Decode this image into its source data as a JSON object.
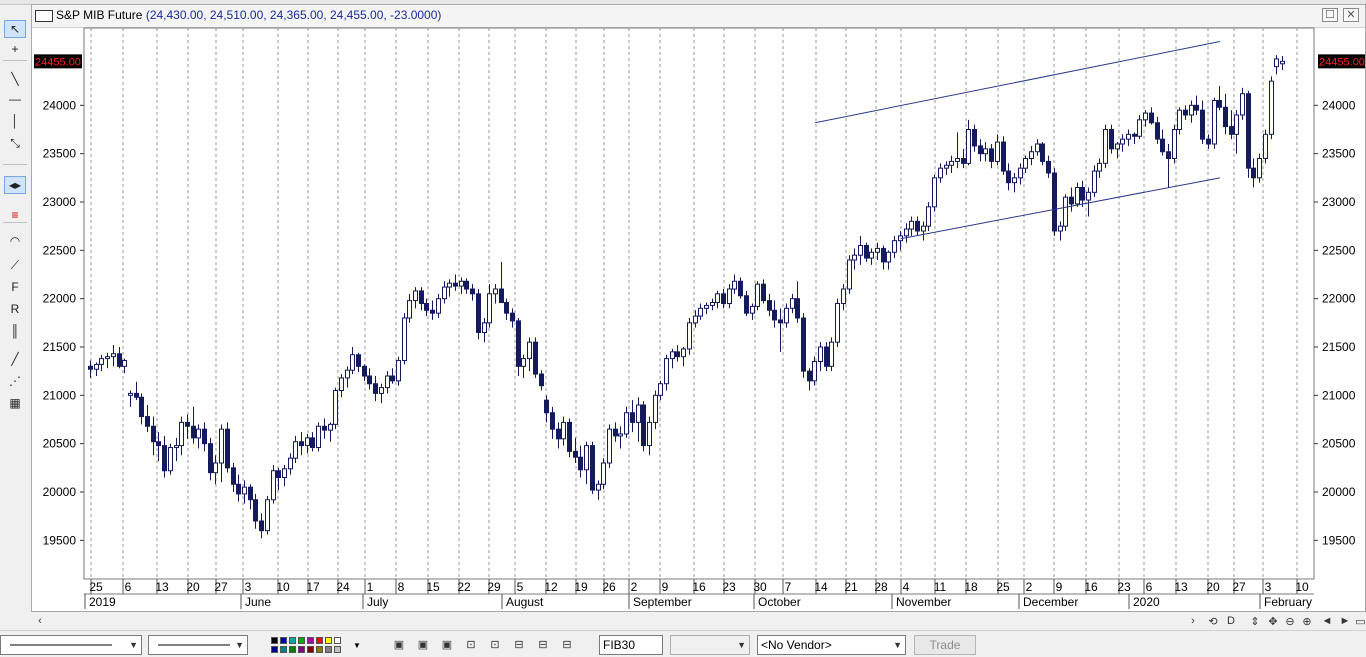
{
  "window": {
    "symbol": "S&P MIB Future",
    "ohlc": "(24,430.00, 24,510.00, 24,365.00, 24,455.00, -23.0000)",
    "restore_glyph": "☐",
    "close_glyph": "✕"
  },
  "price_tag": "24455.00",
  "tools": [
    {
      "name": "pointer-tool-icon",
      "glyph": "↖"
    },
    {
      "name": "crosshair-tool-icon",
      "glyph": "+"
    },
    {
      "name": "trendline-tool-icon",
      "glyph": "╲"
    },
    {
      "name": "horizontal-line-tool-icon",
      "glyph": "—"
    },
    {
      "name": "vertical-line-tool-icon",
      "glyph": "│"
    },
    {
      "name": "cycle-tool-icon",
      "glyph": "⤡"
    },
    {
      "name": "cursor-both-icon",
      "glyph": "◂▸"
    },
    {
      "name": "color-bars-tool-icon",
      "glyph": "≡"
    },
    {
      "name": "arc-tool-icon",
      "glyph": "◠"
    },
    {
      "name": "fan-tool-icon",
      "glyph": "⟋"
    },
    {
      "name": "fibonacci-tool-icon",
      "glyph": "F"
    },
    {
      "name": "retracement-tool-icon",
      "glyph": "R"
    },
    {
      "name": "time-zones-tool-icon",
      "glyph": "║"
    },
    {
      "name": "line-tool-icon",
      "glyph": "╱"
    },
    {
      "name": "speed-lines-tool-icon",
      "glyph": "⋰"
    },
    {
      "name": "grid-tool-icon",
      "glyph": "▦"
    }
  ],
  "colors": {
    "up": "#ffffff",
    "down": "#141a5c",
    "outline": "#141a5c",
    "channel": "#2a3a8c",
    "price_tag_bg": "#000000",
    "price_tag_fg": "#ff2020"
  },
  "chart_data": {
    "type": "candlestick",
    "symbol": "S&P MIB Future",
    "y_ticks": [
      "24000",
      "23500",
      "23000",
      "22500",
      "22000",
      "21500",
      "21000",
      "20500",
      "20000",
      "19500"
    ],
    "ylim": [
      19100,
      24800
    ],
    "x_day_labels": [
      "25",
      "6",
      "13",
      "20",
      "27",
      "3",
      "10",
      "17",
      "24",
      "1",
      "8",
      "15",
      "22",
      "29",
      "5",
      "12",
      "19",
      "26",
      "2",
      "9",
      "16",
      "23",
      "30",
      "7",
      "14",
      "21",
      "28",
      "4",
      "11",
      "18",
      "25",
      "2",
      "9",
      "16",
      "23",
      "6",
      "13",
      "20",
      "27",
      "3",
      "10"
    ],
    "x_month_labels": [
      "2019",
      "June",
      "July",
      "August",
      "September",
      "October",
      "November",
      "December",
      "2020",
      "February"
    ],
    "last": {
      "open": 24430.0,
      "high": 24510.0,
      "low": 24365.0,
      "close": 24455.0,
      "change": -23.0
    },
    "channel_lines": [
      {
        "from": {
          "date": "2019-11-11",
          "value": 23820
        },
        "to": {
          "date": "2020-02-11",
          "value": 24660
        }
      },
      {
        "from": {
          "date": "2019-12-02",
          "value": 22620
        },
        "to": {
          "date": "2020-02-11",
          "value": 23250
        }
      }
    ],
    "bars": [
      [
        21300,
        21360,
        21180,
        21270
      ],
      [
        21270,
        21340,
        21200,
        21320
      ],
      [
        21320,
        21420,
        21250,
        21380
      ],
      [
        21380,
        21440,
        21280,
        21400
      ],
      [
        21400,
        21520,
        21300,
        21430
      ],
      [
        21430,
        21500,
        21280,
        21300
      ],
      [
        21300,
        21380,
        21230,
        21360
      ],
      [
        21000,
        21050,
        20880,
        21020
      ],
      [
        21020,
        21140,
        20950,
        20980
      ],
      [
        20980,
        21020,
        20700,
        20780
      ],
      [
        20780,
        20900,
        20620,
        20680
      ],
      [
        20680,
        20780,
        20380,
        20520
      ],
      [
        20520,
        20620,
        20320,
        20480
      ],
      [
        20480,
        20580,
        20150,
        20220
      ],
      [
        20220,
        20500,
        20180,
        20460
      ],
      [
        20460,
        20560,
        20320,
        20480
      ],
      [
        20480,
        20780,
        20380,
        20720
      ],
      [
        20720,
        20800,
        20550,
        20680
      ],
      [
        20680,
        20880,
        20500,
        20560
      ],
      [
        20560,
        20700,
        20450,
        20650
      ],
      [
        20650,
        20720,
        20420,
        20500
      ],
      [
        20500,
        20560,
        20120,
        20200
      ],
      [
        20200,
        20380,
        20080,
        20300
      ],
      [
        20300,
        20700,
        20100,
        20650
      ],
      [
        20650,
        20720,
        20200,
        20250
      ],
      [
        20250,
        20300,
        20000,
        20080
      ],
      [
        20080,
        20180,
        19900,
        19980
      ],
      [
        19980,
        20120,
        19880,
        20050
      ],
      [
        20050,
        20080,
        19820,
        19920
      ],
      [
        19920,
        19980,
        19620,
        19700
      ],
      [
        19700,
        19780,
        19520,
        19600
      ],
      [
        19600,
        19960,
        19560,
        19920
      ],
      [
        19920,
        20280,
        19880,
        20220
      ],
      [
        20220,
        20250,
        20020,
        20150
      ],
      [
        20150,
        20280,
        20060,
        20240
      ],
      [
        20240,
        20400,
        20180,
        20350
      ],
      [
        20350,
        20580,
        20300,
        20520
      ],
      [
        20520,
        20620,
        20380,
        20480
      ],
      [
        20480,
        20600,
        20400,
        20560
      ],
      [
        20560,
        20620,
        20420,
        20460
      ],
      [
        20460,
        20720,
        20420,
        20680
      ],
      [
        20680,
        20760,
        20550,
        20640
      ],
      [
        20640,
        20720,
        20520,
        20700
      ],
      [
        20700,
        21080,
        20650,
        21050
      ],
      [
        21050,
        21220,
        20980,
        21180
      ],
      [
        21180,
        21300,
        21080,
        21260
      ],
      [
        21260,
        21500,
        21220,
        21420
      ],
      [
        21420,
        21440,
        21240,
        21300
      ],
      [
        21300,
        21320,
        21150,
        21200
      ],
      [
        21200,
        21280,
        21060,
        21120
      ],
      [
        21120,
        21200,
        20940,
        21020
      ],
      [
        21020,
        21120,
        20920,
        21080
      ],
      [
        21080,
        21250,
        21020,
        21200
      ],
      [
        21200,
        21280,
        21120,
        21150
      ],
      [
        21150,
        21400,
        21100,
        21360
      ],
      [
        21360,
        21850,
        21320,
        21800
      ],
      [
        21800,
        22050,
        21750,
        21980
      ],
      [
        21980,
        22120,
        21900,
        22080
      ],
      [
        22080,
        22120,
        21880,
        21950
      ],
      [
        21950,
        22000,
        21820,
        21880
      ],
      [
        21880,
        21980,
        21780,
        21850
      ],
      [
        21850,
        22050,
        21800,
        22000
      ],
      [
        22000,
        22180,
        21950,
        22120
      ],
      [
        22120,
        22200,
        22020,
        22160
      ],
      [
        22160,
        22250,
        22080,
        22130
      ],
      [
        22130,
        22220,
        22050,
        22180
      ],
      [
        22180,
        22210,
        22050,
        22100
      ],
      [
        22100,
        22150,
        21980,
        22050
      ],
      [
        22050,
        22100,
        21580,
        21650
      ],
      [
        21650,
        21800,
        21550,
        21750
      ],
      [
        21750,
        22150,
        21700,
        22050
      ],
      [
        22050,
        22150,
        21950,
        22100
      ],
      [
        22100,
        22380,
        22000,
        21960
      ],
      [
        21960,
        22000,
        21780,
        21850
      ],
      [
        21850,
        21900,
        21700,
        21770
      ],
      [
        21770,
        21800,
        21200,
        21300
      ],
      [
        21300,
        21420,
        21180,
        21380
      ],
      [
        21380,
        21600,
        21250,
        21550
      ],
      [
        21550,
        21600,
        21180,
        21220
      ],
      [
        21220,
        21260,
        21050,
        21100
      ],
      [
        20950,
        21000,
        20720,
        20820
      ],
      [
        20820,
        20880,
        20550,
        20650
      ],
      [
        20650,
        20720,
        20450,
        20550
      ],
      [
        20550,
        20780,
        20480,
        20720
      ],
      [
        20720,
        20760,
        20360,
        20420
      ],
      [
        20420,
        20560,
        20300,
        20360
      ],
      [
        20360,
        20480,
        20150,
        20230
      ],
      [
        20230,
        20520,
        20080,
        20480
      ],
      [
        20480,
        20520,
        19980,
        20020
      ],
      [
        20020,
        20120,
        19920,
        20080
      ],
      [
        20080,
        20350,
        20030,
        20300
      ],
      [
        20300,
        20700,
        20250,
        20650
      ],
      [
        20650,
        20720,
        20520,
        20580
      ],
      [
        20580,
        20680,
        20450,
        20600
      ],
      [
        20600,
        20880,
        20560,
        20820
      ],
      [
        20820,
        20950,
        20620,
        20720
      ],
      [
        20720,
        20980,
        20520,
        20900
      ],
      [
        20900,
        20940,
        20420,
        20480
      ],
      [
        20480,
        20780,
        20380,
        20720
      ],
      [
        20720,
        21050,
        20650,
        21000
      ],
      [
        21000,
        21150,
        20950,
        21120
      ],
      [
        21120,
        21420,
        21050,
        21380
      ],
      [
        21380,
        21480,
        21280,
        21450
      ],
      [
        21450,
        21520,
        21350,
        21400
      ],
      [
        21400,
        21500,
        21300,
        21480
      ],
      [
        21480,
        21800,
        21420,
        21750
      ],
      [
        21750,
        21880,
        21700,
        21820
      ],
      [
        21820,
        21950,
        21780,
        21900
      ],
      [
        21900,
        21960,
        21840,
        21930
      ],
      [
        21930,
        22000,
        21880,
        21960
      ],
      [
        21960,
        22080,
        21900,
        22050
      ],
      [
        22050,
        22100,
        21900,
        21950
      ],
      [
        21950,
        22150,
        21900,
        22100
      ],
      [
        22100,
        22250,
        22050,
        22180
      ],
      [
        22180,
        22220,
        22000,
        22030
      ],
      [
        22030,
        22080,
        21820,
        21850
      ],
      [
        21850,
        21950,
        21780,
        21920
      ],
      [
        21920,
        22180,
        21880,
        22150
      ],
      [
        22150,
        22200,
        21950,
        21980
      ],
      [
        21980,
        22050,
        21820,
        21880
      ],
      [
        21880,
        21980,
        21700,
        21780
      ],
      [
        21780,
        21900,
        21450,
        21750
      ],
      [
        21750,
        21950,
        21700,
        21900
      ],
      [
        21900,
        22050,
        21850,
        22000
      ],
      [
        22000,
        22180,
        21750,
        21800
      ],
      [
        21800,
        21850,
        21180,
        21250
      ],
      [
        21250,
        21280,
        21050,
        21150
      ],
      [
        21150,
        21400,
        21100,
        21350
      ],
      [
        21350,
        21550,
        21250,
        21500
      ],
      [
        21500,
        21550,
        21250,
        21300
      ],
      [
        21300,
        21600,
        21250,
        21550
      ],
      [
        21550,
        22000,
        21500,
        21950
      ],
      [
        21950,
        22150,
        21880,
        22100
      ],
      [
        22100,
        22450,
        22050,
        22400
      ],
      [
        22400,
        22520,
        22300,
        22450
      ],
      [
        22450,
        22650,
        22350,
        22550
      ],
      [
        22550,
        22580,
        22380,
        22420
      ],
      [
        22420,
        22520,
        22350,
        22480
      ],
      [
        22480,
        22580,
        22400,
        22520
      ],
      [
        22520,
        22550,
        22300,
        22380
      ],
      [
        22380,
        22500,
        22300,
        22480
      ],
      [
        22480,
        22650,
        22420,
        22600
      ],
      [
        22600,
        22700,
        22500,
        22650
      ],
      [
        22650,
        22780,
        22580,
        22720
      ],
      [
        22720,
        22850,
        22650,
        22800
      ],
      [
        22800,
        22850,
        22650,
        22700
      ],
      [
        22700,
        22800,
        22600,
        22750
      ],
      [
        22750,
        23000,
        22700,
        22950
      ],
      [
        22950,
        23280,
        22900,
        23250
      ],
      [
        23250,
        23400,
        23200,
        23350
      ],
      [
        23350,
        23420,
        23280,
        23380
      ],
      [
        23380,
        23480,
        23300,
        23420
      ],
      [
        23420,
        23720,
        23350,
        23450
      ],
      [
        23450,
        23550,
        23350,
        23400
      ],
      [
        23400,
        23850,
        23380,
        23750
      ],
      [
        23750,
        23800,
        23520,
        23580
      ],
      [
        23580,
        23650,
        23420,
        23500
      ],
      [
        23500,
        23620,
        23420,
        23550
      ],
      [
        23550,
        23600,
        23350,
        23420
      ],
      [
        23420,
        23700,
        23380,
        23620
      ],
      [
        23620,
        23680,
        23280,
        23320
      ],
      [
        23320,
        23400,
        23120,
        23200
      ],
      [
        23200,
        23300,
        23100,
        23250
      ],
      [
        23250,
        23400,
        23180,
        23350
      ],
      [
        23350,
        23480,
        23300,
        23450
      ],
      [
        23450,
        23580,
        23380,
        23520
      ],
      [
        23520,
        23650,
        23480,
        23600
      ],
      [
        23600,
        23620,
        23380,
        23420
      ],
      [
        23420,
        23480,
        23250,
        23300
      ],
      [
        23300,
        23350,
        22650,
        22700
      ],
      [
        22700,
        22800,
        22600,
        22750
      ],
      [
        22750,
        23080,
        22700,
        23050
      ],
      [
        23050,
        23150,
        22900,
        22980
      ],
      [
        22980,
        23200,
        22950,
        23150
      ],
      [
        23150,
        23220,
        22950,
        23020
      ],
      [
        23020,
        23150,
        22850,
        23100
      ],
      [
        23100,
        23380,
        23050,
        23320
      ],
      [
        23320,
        23450,
        23250,
        23400
      ],
      [
        23400,
        23800,
        23350,
        23750
      ],
      [
        23750,
        23800,
        23500,
        23550
      ],
      [
        23550,
        23620,
        23450,
        23600
      ],
      [
        23600,
        23700,
        23520,
        23650
      ],
      [
        23650,
        23750,
        23580,
        23700
      ],
      [
        23700,
        23720,
        23600,
        23680
      ],
      [
        23680,
        23900,
        23650,
        23850
      ],
      [
        23850,
        23950,
        23780,
        23920
      ],
      [
        23920,
        23980,
        23800,
        23820
      ],
      [
        23820,
        23880,
        23600,
        23650
      ],
      [
        23650,
        23750,
        23480,
        23520
      ],
      [
        23520,
        23600,
        23150,
        23450
      ],
      [
        23450,
        23800,
        23400,
        23750
      ],
      [
        23750,
        23980,
        23700,
        23950
      ],
      [
        23950,
        24000,
        23850,
        23900
      ],
      [
        23900,
        24050,
        23820,
        24000
      ],
      [
        24000,
        24100,
        23900,
        23950
      ],
      [
        23950,
        24050,
        23600,
        23650
      ],
      [
        23650,
        23700,
        23550,
        23600
      ],
      [
        23600,
        24080,
        23550,
        24050
      ],
      [
        24050,
        24200,
        23950,
        23980
      ],
      [
        23980,
        24120,
        23700,
        23780
      ],
      [
        23780,
        23950,
        23650,
        23700
      ],
      [
        23700,
        23950,
        23500,
        23900
      ],
      [
        23900,
        24180,
        23850,
        24120
      ],
      [
        24120,
        24150,
        23250,
        23350
      ],
      [
        23350,
        23450,
        23150,
        23250
      ],
      [
        23250,
        23500,
        23200,
        23450
      ],
      [
        23450,
        23750,
        23400,
        23700
      ],
      [
        23700,
        24300,
        23650,
        24250
      ],
      [
        24400,
        24520,
        24320,
        24480
      ],
      [
        24430,
        24510,
        24365,
        24455
      ]
    ]
  },
  "x_scroll": {
    "left": "‹",
    "right": "›"
  },
  "nav_buttons": [
    {
      "name": "zoom-out-x-icon",
      "glyph": "⊖"
    },
    {
      "name": "zoom-in-x-icon",
      "glyph": "⊕"
    },
    {
      "name": "scroll-start-icon",
      "glyph": "◄"
    },
    {
      "name": "scroll-end-icon",
      "glyph": "►"
    }
  ],
  "period_buttons": [
    "D"
  ],
  "bottom": {
    "symbol_field": "FIB30",
    "vendor": "<No Vendor>",
    "trade": "Trade"
  }
}
